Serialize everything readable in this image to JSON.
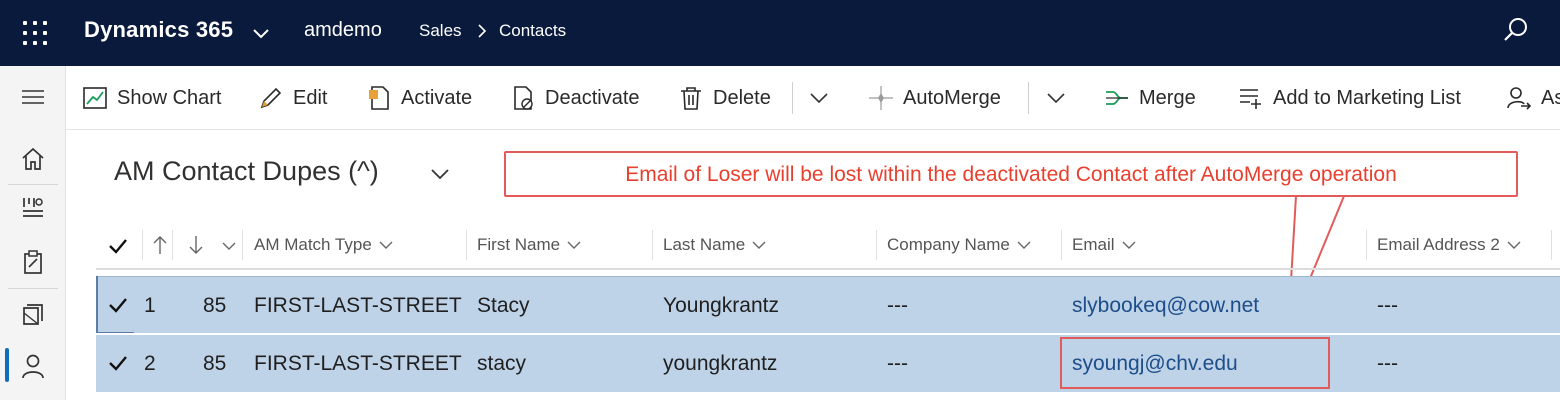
{
  "header": {
    "app_title": "Dynamics 365",
    "org_name": "amdemo",
    "breadcrumb": [
      "Sales",
      "Contacts"
    ],
    "bg_color": "#0a1a3c"
  },
  "left_nav": {
    "icons": [
      "hamburger-icon",
      "home-icon",
      "recent-icon",
      "clipboard-icon",
      "pinned-icon",
      "contact-icon"
    ],
    "active_index": 5,
    "accent_color": "#0f6cbd"
  },
  "command_bar": {
    "items": [
      {
        "label": "Show Chart",
        "icon": "chart-icon"
      },
      {
        "label": "Edit",
        "icon": "pencil-icon"
      },
      {
        "label": "Activate",
        "icon": "activate-icon"
      },
      {
        "label": "Deactivate",
        "icon": "deactivate-icon"
      },
      {
        "label": "Delete",
        "icon": "trash-icon"
      },
      {
        "label": "AutoMerge",
        "icon": "automerge-icon"
      },
      {
        "label": "Merge",
        "icon": "merge-icon"
      },
      {
        "label": "Add to Marketing List",
        "icon": "list-add-icon"
      },
      {
        "label": "As",
        "icon": "assign-icon"
      }
    ]
  },
  "view": {
    "title": "AM Contact Dupes (^)"
  },
  "callout": {
    "text": "Email of Loser will be lost within the deactivated Contact after AutoMerge operation",
    "color": "#e8402f"
  },
  "grid": {
    "columns": [
      "AM Match Type",
      "First Name",
      "Last Name",
      "Company Name",
      "Email",
      "Email Address 2"
    ],
    "rows": [
      {
        "index": "1",
        "score": "85",
        "match_type": "FIRST-LAST-STREET",
        "first": "Stacy",
        "last": "Youngkrantz",
        "company": "---",
        "email": "slybookeq@cow.net",
        "email2": "---"
      },
      {
        "index": "2",
        "score": "85",
        "match_type": "FIRST-LAST-STREET",
        "first": "stacy",
        "last": "youngkrantz",
        "company": "---",
        "email": "syoungj@chv.edu",
        "email2": "---"
      }
    ],
    "selected_color": "#bfd3e8"
  }
}
